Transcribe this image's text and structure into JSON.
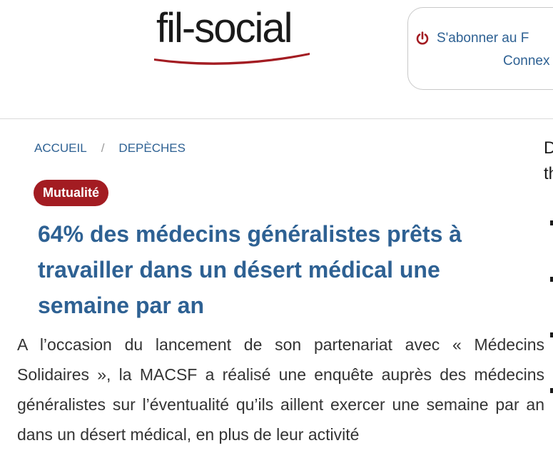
{
  "header": {
    "logo_text": "fil-social",
    "subscribe": {
      "line1": "S'abonner au F",
      "line2": "Connex",
      "icon": "power-icon"
    },
    "colors": {
      "brand_red": "#a31c22",
      "link_blue": "#2e6193"
    }
  },
  "breadcrumb": {
    "home": "ACCUEIL",
    "separator": "/",
    "section": "DEPÈCHES"
  },
  "article": {
    "category": "Mutualité",
    "title": "64% des médecins généralistes prêts à travailler dans un désert médical une semaine par an",
    "body": "A l’occasion du lancement de son partenariat avec « Médecins Solidaires », la MACSF a réalisé une enquête auprès des médecins généralistes sur l’éventualité qu’ils aillent exercer une semaine par an dans un désert médical, en plus de leur activité"
  },
  "sidebar": {
    "line1": "D",
    "line2": "th"
  }
}
